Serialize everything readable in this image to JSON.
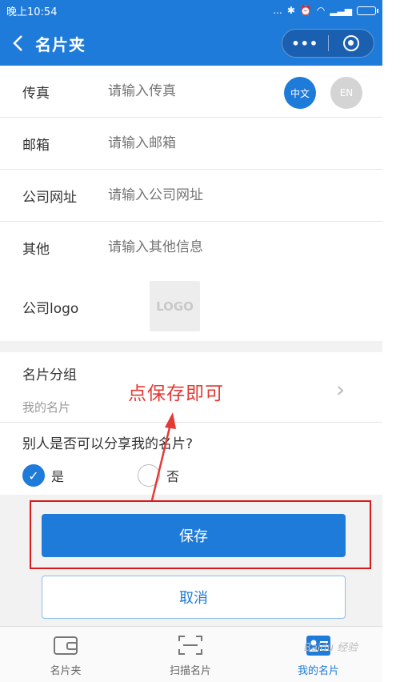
{
  "status_bar": {
    "time": "晚上10:54",
    "signal": "...",
    "icons": [
      "bluetooth-icon",
      "alarm-icon",
      "wifi-icon",
      "signal-icon",
      "battery-icon"
    ]
  },
  "nav": {
    "title": "名片夹",
    "more_label": "•••"
  },
  "lang": {
    "zh": "中文",
    "en": "EN"
  },
  "form": {
    "rows": [
      {
        "label": "传真",
        "placeholder": "请输入传真"
      },
      {
        "label": "邮箱",
        "placeholder": "请输入邮箱"
      },
      {
        "label": "公司网址",
        "placeholder": "请输入公司网址"
      },
      {
        "label": "其他",
        "placeholder": "请输入其他信息"
      }
    ]
  },
  "logo": {
    "label": "公司logo",
    "placeholder_text": "LOGO"
  },
  "group": {
    "title": "名片分组",
    "value": "我的名片",
    "chevron": "›"
  },
  "share": {
    "question": "别人是否可以分享我的名片?",
    "yes": "是",
    "no": "否",
    "selected": "是"
  },
  "buttons": {
    "save": "保存",
    "cancel": "取消"
  },
  "annotation": {
    "text": "点保存即可",
    "color": "#e53935"
  },
  "tabs": [
    {
      "label": "名片夹",
      "icon": "wallet-icon"
    },
    {
      "label": "扫描名片",
      "icon": "scan-icon"
    },
    {
      "label": "我的名片",
      "icon": "profile-card-icon",
      "active": true
    }
  ],
  "watermark": "Baidu 经验",
  "colors": {
    "primary": "#1f7bd9",
    "annotation": "#d7191c"
  }
}
